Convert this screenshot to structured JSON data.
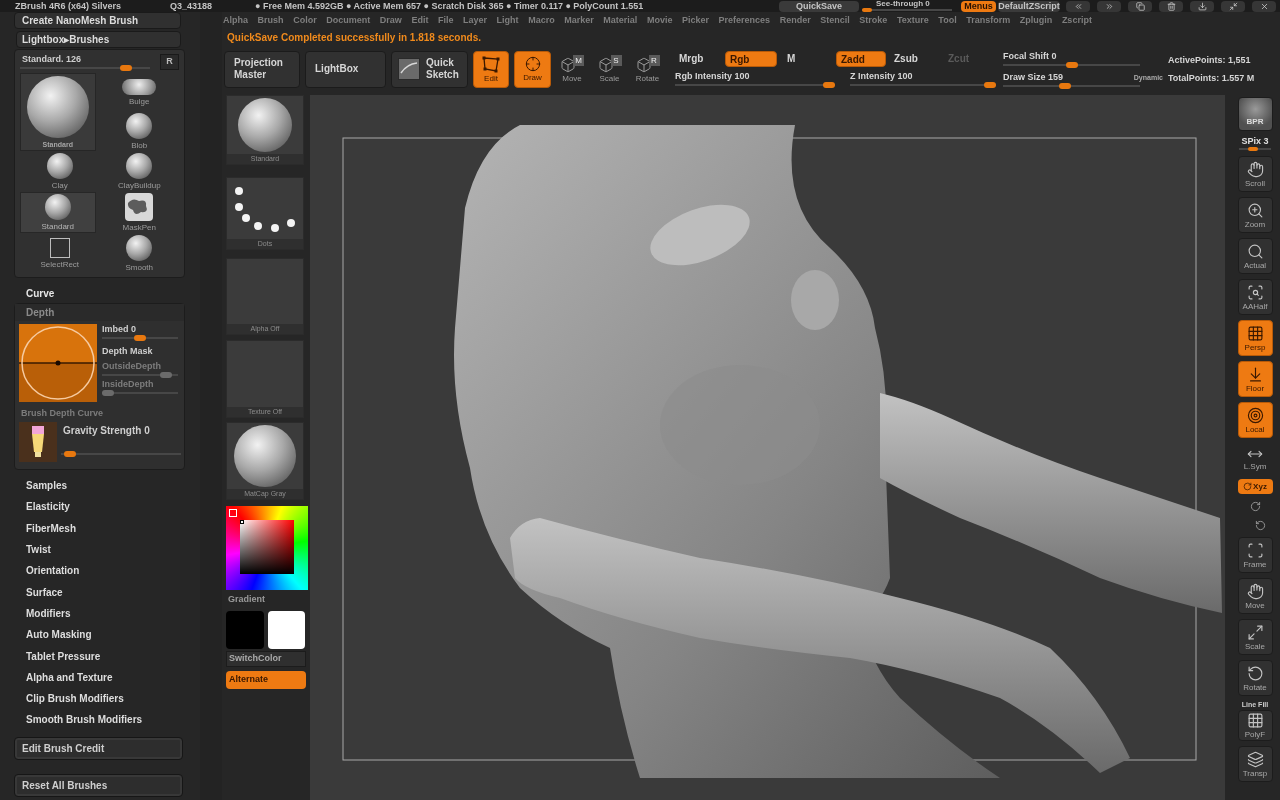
{
  "title_bar": {
    "app": "ZBrush 4R6 (x64) Silvers",
    "document": "Q3_43188",
    "stats": "● Free Mem 4.592GB ● Active Mem 657 ● Scratch Disk 365 ● Timer 0.117 ● PolyCount 1.551",
    "quicksave": "QuickSave",
    "see_through": {
      "label": "See-through 0",
      "level": 0
    },
    "menus": {
      "label": "Menus",
      "on": true
    },
    "script": "DefaultZScript"
  },
  "menu_bar": [
    "Alpha",
    "Brush",
    "Color",
    "Document",
    "Draw",
    "Edit",
    "File",
    "Layer",
    "Light",
    "Macro",
    "Marker",
    "Material",
    "Movie",
    "Picker",
    "Preferences",
    "Render",
    "Stencil",
    "Stroke",
    "Texture",
    "Tool",
    "Transform",
    "Zplugin",
    "Zscript"
  ],
  "notification": "QuickSave Completed successfully in 1.818 seconds.",
  "top_shelf": {
    "buttons": [
      {
        "label": "Projection Master",
        "kind": "projection",
        "on": false
      },
      {
        "label": "LightBox",
        "kind": "lightbox",
        "on": false
      },
      {
        "label": "Quick Sketch",
        "kind": "sketch",
        "on": false
      },
      {
        "label": "Edit",
        "kind": "edit",
        "on": true
      },
      {
        "label": "Draw",
        "kind": "draw",
        "on": true
      },
      {
        "label": "Move",
        "kind": "move",
        "badge": "M",
        "on": false
      },
      {
        "label": "Scale",
        "kind": "scale",
        "badge": "S",
        "on": false
      },
      {
        "label": "Rotate",
        "kind": "rotate",
        "badge": "R",
        "on": false
      }
    ],
    "color_modes": [
      {
        "label": "Mrgb",
        "selected": false
      },
      {
        "label": "Rgb",
        "selected": true
      },
      {
        "label": "M",
        "selected": false
      }
    ],
    "rgb_intensity": {
      "label": "Rgb Intensity 100",
      "level": 1
    },
    "z_modes": [
      {
        "label": "Zadd",
        "selected": true,
        "disabled": false
      },
      {
        "label": "Zsub",
        "selected": false,
        "disabled": false
      },
      {
        "label": "Zcut",
        "selected": false,
        "disabled": true
      }
    ],
    "z_intensity": {
      "label": "Z Intensity 100",
      "level": 1
    },
    "focal_shift": {
      "label": "Focal Shift 0",
      "level": 0.5
    },
    "draw_size": {
      "label": "Draw Size 159",
      "level": 0.45
    },
    "dynamic": "Dynamic",
    "active_points": "ActivePoints: 1,551",
    "total_points": "TotalPoints: 1.557 M"
  },
  "tray": {
    "create_nanomesh": "Create NanoMesh Brush",
    "lightbox_brushes": "Lightbox▸Brushes",
    "brush_slider": {
      "label": "Standard. 126",
      "level": 0.85
    },
    "reset_brush": "R",
    "current_brush": {
      "label": "Standard"
    },
    "brushes": [
      {
        "label": "Bulge",
        "kind": "bulge",
        "selected": false
      },
      {
        "label": "Blob",
        "kind": "sphere",
        "selected": false
      },
      {
        "label": "Clay",
        "kind": "sphere",
        "selected": false
      },
      {
        "label": "ClayBuildup",
        "kind": "sphere",
        "selected": false
      },
      {
        "label": "Standard",
        "kind": "sphere",
        "selected": true
      },
      {
        "label": "MaskPen",
        "kind": "mask",
        "selected": false
      },
      {
        "label": "SelectRect",
        "kind": "rect",
        "selected": false
      },
      {
        "label": "Smooth",
        "kind": "sphere",
        "selected": false
      }
    ],
    "curve": {
      "label": "Curve",
      "expanded": false
    },
    "depth": {
      "label": "Depth",
      "expanded": true
    },
    "depth_panel": {
      "imbed": {
        "label": "Imbed 0",
        "level": 0.5
      },
      "depth_mask": "Depth Mask",
      "outside_depth": {
        "label": "OutsideDepth",
        "level": 0.9,
        "disabled": true
      },
      "inside_depth": {
        "label": "InsideDepth",
        "level": 0,
        "disabled": true
      },
      "depth_curve": {
        "label": "Brush Depth Curve",
        "disabled": true
      },
      "gravity": {
        "label": "Gravity Strength 0",
        "level": 0.03
      }
    },
    "subpalettes": [
      "Samples",
      "Elasticity",
      "FiberMesh",
      "Twist",
      "Orientation",
      "Surface",
      "Modifiers",
      "Auto Masking",
      "Tablet Pressure",
      "Alpha and Texture",
      "Clip Brush Modifiers",
      "Smooth Brush Modifiers"
    ],
    "edit_credit": "Edit Brush Credit",
    "reset_all": "Reset All Brushes"
  },
  "left_shelf": {
    "brush": "Standard",
    "stroke": "Dots",
    "alpha": "Alpha Off",
    "texture": "Texture Off",
    "material": "MatCap Gray",
    "gradient": "Gradient",
    "swatches": [
      {
        "color": "#000000"
      },
      {
        "color": "#ffffff"
      }
    ],
    "switch_color": "SwitchColor",
    "alternate": {
      "label": "Alternate",
      "on": true
    }
  },
  "right_shelf": {
    "bpr": {
      "label": "BPR",
      "on": false
    },
    "spix": {
      "label": "SPix 3",
      "level": 0.4
    },
    "buttons": [
      {
        "label": "Scroll",
        "kind": "scroll",
        "on": false
      },
      {
        "label": "Zoom",
        "kind": "zoom",
        "on": false
      },
      {
        "label": "Actual",
        "kind": "actual",
        "on": false
      },
      {
        "label": "AAHalf",
        "kind": "aahalf",
        "on": false
      },
      {
        "label": "Persp",
        "kind": "persp",
        "on": true
      },
      {
        "label": "Floor",
        "kind": "floor",
        "on": true
      },
      {
        "label": "Local",
        "kind": "local",
        "on": true
      },
      {
        "label": "L.Sym",
        "kind": "lsym",
        "on": false
      },
      {
        "label": "Xyz",
        "kind": "xyz",
        "on": true
      },
      {
        "label": "Frame",
        "kind": "frame",
        "on": false
      },
      {
        "label": "Move",
        "kind": "move",
        "on": false
      },
      {
        "label": "Scale",
        "kind": "scale",
        "on": false
      },
      {
        "label": "Rotate",
        "kind": "rotate",
        "on": false
      },
      {
        "label": "PolyF",
        "kind": "polyf",
        "caption": "Line Fill",
        "on": false
      },
      {
        "label": "Transp",
        "kind": "transp",
        "on": false
      }
    ]
  }
}
